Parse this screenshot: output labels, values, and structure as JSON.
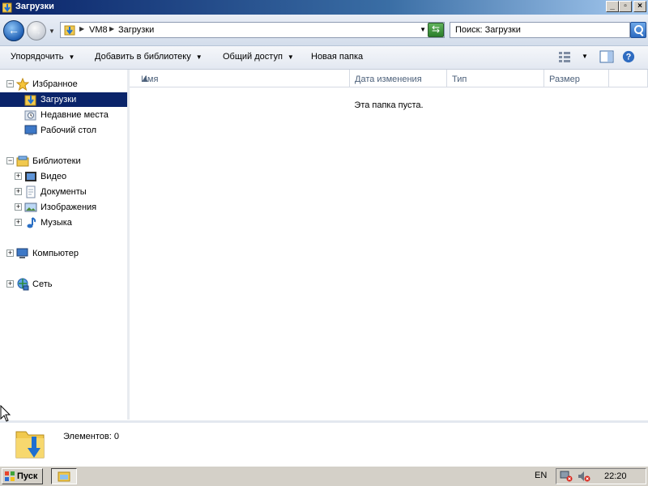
{
  "window": {
    "title": "Загрузки"
  },
  "address": {
    "crumbs": [
      "VM8",
      "Загрузки"
    ]
  },
  "search": {
    "placeholder": "Поиск: Загрузки"
  },
  "toolbar": {
    "organize_label": "Упорядочить",
    "add_to_library_label": "Добавить в библиотеку",
    "share_label": "Общий доступ",
    "new_folder_label": "Новая папка"
  },
  "nav": {
    "favorites": {
      "label": "Избранное",
      "items": [
        {
          "label": "Загрузки",
          "icon": "downloads-folder-icon",
          "selected": true
        },
        {
          "label": "Недавние места",
          "icon": "recent-places-icon"
        },
        {
          "label": "Рабочий стол",
          "icon": "desktop-icon"
        }
      ]
    },
    "libraries": {
      "label": "Библиотеки",
      "items": [
        {
          "label": "Видео",
          "icon": "video-icon"
        },
        {
          "label": "Документы",
          "icon": "documents-icon"
        },
        {
          "label": "Изображения",
          "icon": "pictures-icon"
        },
        {
          "label": "Музыка",
          "icon": "music-icon"
        }
      ]
    },
    "computer": {
      "label": "Компьютер"
    },
    "network": {
      "label": "Сеть"
    }
  },
  "columns": [
    "Имя",
    "Дата изменения",
    "Тип",
    "Размер"
  ],
  "content": {
    "empty_message": "Эта папка пуста."
  },
  "details": {
    "items_text": "Элементов: 0"
  },
  "taskbar": {
    "start_label": "Пуск",
    "language": "EN",
    "clock": "22:20"
  },
  "colors": {
    "selection": "#0a246a",
    "titlebar": "#0a246a"
  }
}
